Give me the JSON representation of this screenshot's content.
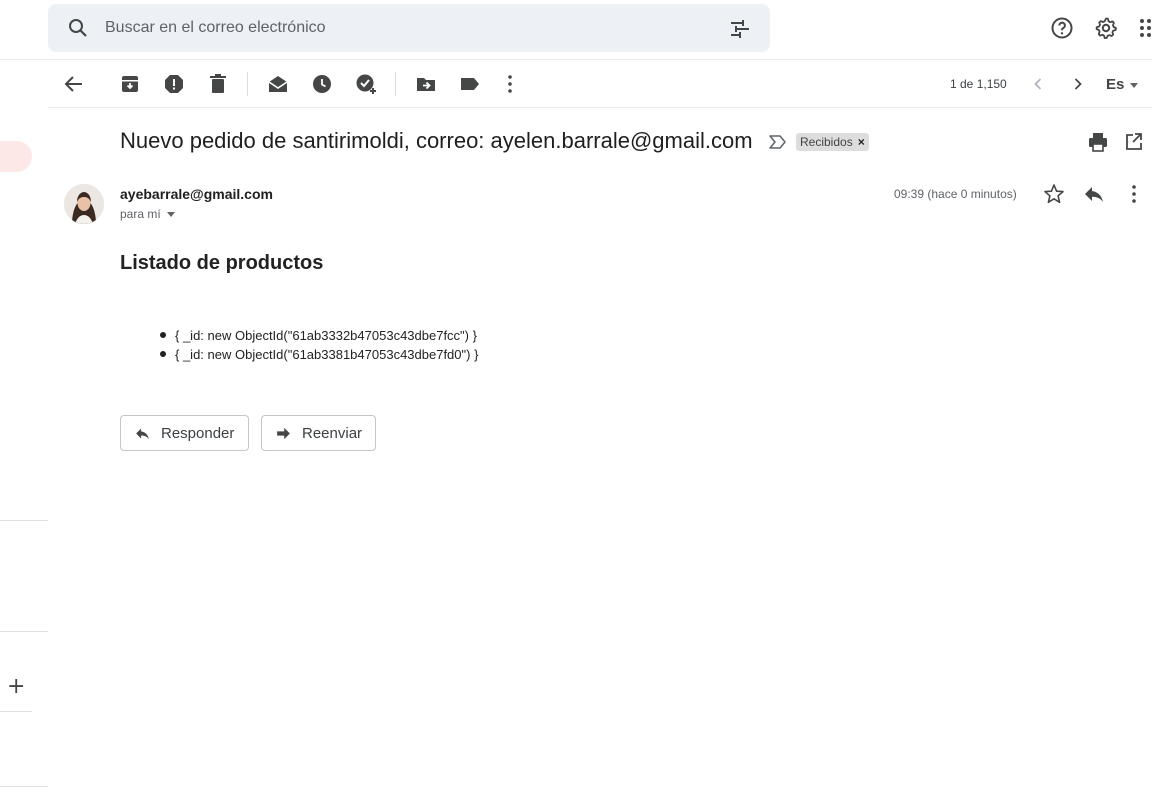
{
  "search": {
    "placeholder": "Buscar en el correo electrónico"
  },
  "toolbar": {
    "pager": "1 de 1,150",
    "lang": "Es"
  },
  "email": {
    "subject": "Nuevo pedido de santirimoldi, correo: ayelen.barrale@gmail.com",
    "label": "Recibidos",
    "label_remove": "×",
    "sender": "ayebarrale@gmail.com",
    "to": "para mí",
    "time": "09:39 (hace 0 minutos)",
    "heading": "Listado de productos",
    "products": [
      "{ _id: new ObjectId(\"61ab3332b47053c43dbe7fcc\") }",
      "{ _id: new ObjectId(\"61ab3381b47053c43dbe7fd0\") }"
    ]
  },
  "actions": {
    "reply": "Responder",
    "forward": "Reenviar"
  },
  "sidebar": {
    "add": "+"
  },
  "colors": {
    "icon": "#444746",
    "accent_pill": "#fce8e6",
    "search_bg": "#edf0f4"
  }
}
